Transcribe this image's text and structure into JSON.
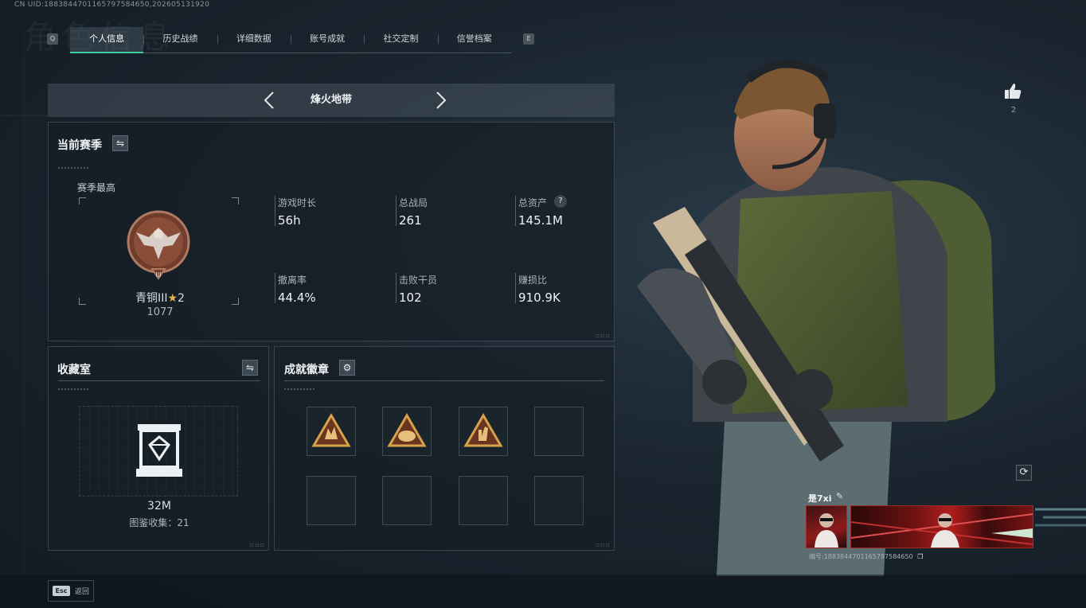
{
  "uid_line": "CN UID:1883844701165797584650,202605131920",
  "bg_title": "角色信息",
  "tabs": {
    "left_key": "Q",
    "right_key": "E",
    "items": [
      "个人信息",
      "历史战绩",
      "详细数据",
      "账号成就",
      "社交定制",
      "信誉档案"
    ],
    "active_index": 0
  },
  "mode": {
    "label": "烽火地带"
  },
  "season": {
    "title": "当前赛季",
    "best_label": "赛季最高",
    "rank_name": "青铜III",
    "rank_stars": "2",
    "rank_score": "1077",
    "rank_emblem_numeral": "III",
    "stats": [
      {
        "label": "游戏时长",
        "value": "56h"
      },
      {
        "label": "总战局",
        "value": "261"
      },
      {
        "label": "总资产",
        "value": "145.1M",
        "help": "?"
      },
      {
        "label": "撤离率",
        "value": "44.4%"
      },
      {
        "label": "击败干员",
        "value": "102"
      },
      {
        "label": "赚损比",
        "value": "910.9K"
      }
    ]
  },
  "collection": {
    "title": "收藏室",
    "value": "32M",
    "catalog": "图鉴收集：21"
  },
  "achievements": {
    "title": "成就徽章",
    "badges": [
      "badge-1",
      "badge-2",
      "badge-3",
      "empty",
      "empty",
      "empty",
      "empty",
      "empty"
    ]
  },
  "likes": {
    "count": "2"
  },
  "player": {
    "name": "是7xi",
    "id_line": "编号:1883844701165797584650"
  },
  "footer": {
    "esc_key": "Esc",
    "back_label": "返回"
  },
  "colors": {
    "accent": "#3fd0a0",
    "bronze": "#9a5b43",
    "gold_badge": "#d6a24a"
  }
}
